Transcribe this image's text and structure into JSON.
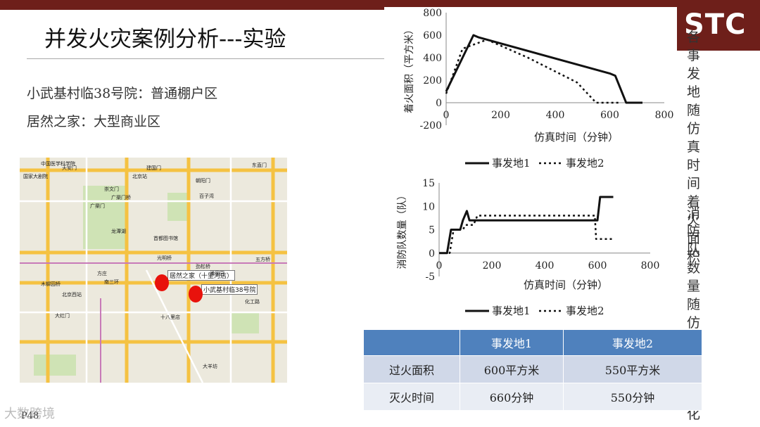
{
  "title": "并发火灾案例分析---实验",
  "logo_text": "STC",
  "subtitles": [
    "小武基村临38号院：普通棚户区",
    "居然之家：大型商业区"
  ],
  "side_labels": [
    "各事发地随仿真时间着火面积",
    "消防队数量随仿真时间变化"
  ],
  "map": {
    "labels": [
      "居然之家（十里河店）",
      "小武基村临38号院",
      "中国医学科学院",
      "国家大剧院",
      "天安门",
      "北京站",
      "崇文门",
      "东直门",
      "建国门",
      "朝阳门",
      "光明桥",
      "劲松桥",
      "潘家园",
      "十八里店",
      "大羊坊",
      "方庄",
      "木樨园桥",
      "南三环",
      "广渠门桥",
      "广渠门",
      "龙潭湖",
      "百子湾",
      "化工路",
      "五方桥",
      "大红门",
      "北京西站",
      "首都图书馆"
    ],
    "colors": {
      "marker": "#e8120c"
    }
  },
  "table": {
    "headers": [
      "",
      "事发地1",
      "事发地2"
    ],
    "rows": [
      [
        "过火面积",
        "600平方米",
        "550平方米"
      ],
      [
        "灭火时间",
        "660分钟",
        "550分钟"
      ]
    ]
  },
  "footer": {
    "watermark": "大数跨境",
    "page": "P48"
  },
  "chart_data": [
    {
      "type": "line",
      "title": "",
      "xlabel": "仿真时间（分钟）",
      "ylabel": "着火面积（平方米）",
      "xlim": [
        0,
        800
      ],
      "ylim": [
        -200,
        800
      ],
      "xticks": [
        0,
        200,
        400,
        600,
        800
      ],
      "yticks": [
        -200,
        0,
        200,
        400,
        600,
        800
      ],
      "legend": "bottom",
      "series": [
        {
          "name": "事发地1",
          "style": "solid",
          "x": [
            0,
            100,
            120,
            600,
            620,
            660,
            720
          ],
          "y": [
            100,
            600,
            580,
            260,
            240,
            0,
            0
          ]
        },
        {
          "name": "事发地2",
          "style": "dotted",
          "x": [
            0,
            60,
            150,
            300,
            480,
            550,
            600,
            640
          ],
          "y": [
            80,
            480,
            560,
            400,
            180,
            0,
            0,
            0
          ]
        }
      ]
    },
    {
      "type": "line",
      "title": "",
      "xlabel": "仿真时间（分钟）",
      "ylabel": "消防队数量（队）",
      "xlim": [
        0,
        800
      ],
      "ylim": [
        -5,
        15
      ],
      "xticks": [
        0,
        200,
        400,
        600,
        800
      ],
      "yticks": [
        -5,
        0,
        5,
        10,
        15
      ],
      "legend": "bottom",
      "series": [
        {
          "name": "事发地1",
          "style": "solid",
          "x": [
            0,
            30,
            45,
            80,
            90,
            105,
            115,
            130,
            180,
            600,
            610,
            660
          ],
          "y": [
            0,
            0,
            5,
            5,
            7,
            9,
            7,
            7,
            7,
            7,
            12,
            12
          ]
        },
        {
          "name": "事发地2",
          "style": "dotted",
          "x": [
            0,
            40,
            55,
            90,
            100,
            130,
            145,
            200,
            590,
            595,
            660
          ],
          "y": [
            0,
            0,
            5,
            5,
            6,
            6,
            8,
            8,
            8,
            3,
            3
          ]
        }
      ]
    }
  ]
}
